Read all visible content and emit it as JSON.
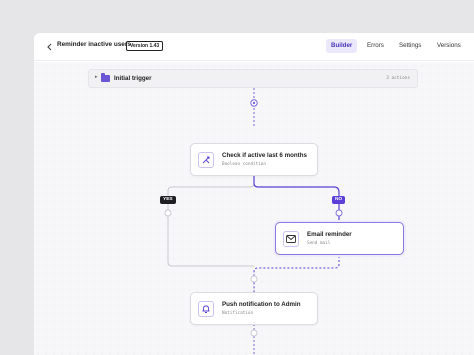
{
  "header": {
    "title": "Reminder inactive users",
    "version": "Version 1.43",
    "tabs": [
      {
        "label": "Builder",
        "active": true
      },
      {
        "label": "Errors",
        "active": false
      },
      {
        "label": "Settings",
        "active": false
      },
      {
        "label": "Versions",
        "active": false
      }
    ]
  },
  "trigger": {
    "label": "Initial trigger",
    "count": "3 actions"
  },
  "nodes": {
    "check": {
      "title": "Check if active last 6 months",
      "subtitle": "Boolean condition",
      "icon": "split-icon"
    },
    "email": {
      "title": "Email reminder",
      "subtitle": "Send mail",
      "icon": "mail-icon"
    },
    "push": {
      "title": "Push notification to Admin",
      "subtitle": "Notification",
      "icon": "bell-icon"
    }
  },
  "branches": {
    "yes": "YES",
    "no": "NO"
  },
  "colors": {
    "accent": "#5b3fd6",
    "yes_badge": "#1f1f24",
    "no_badge": "#5b3fd6",
    "line": "#c9c9d1"
  }
}
